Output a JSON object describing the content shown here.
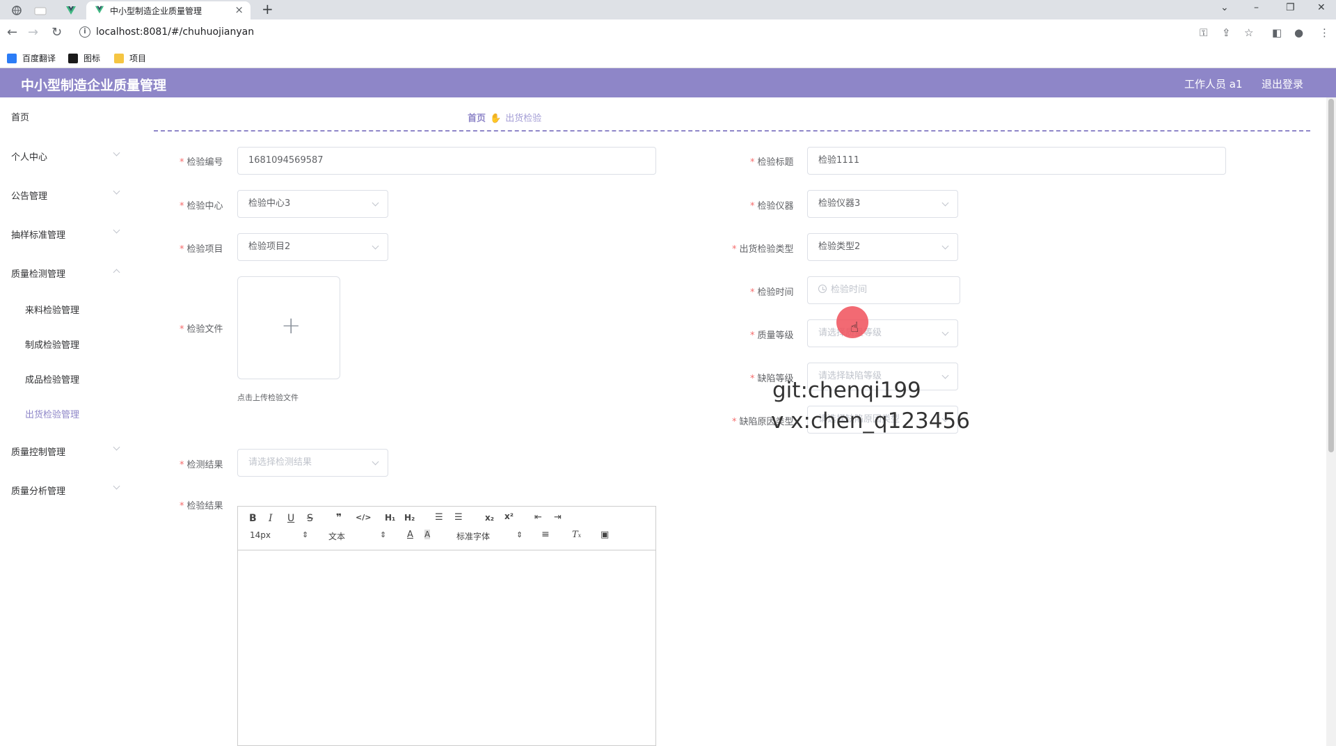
{
  "browser": {
    "tab_title": "中小型制造企业质量管理",
    "tab_close": "×",
    "new_tab": "+",
    "url": "localhost:8081/#/chuhuojianyan",
    "bookmarks": [
      {
        "label": "百度翻译",
        "color": "#2b7cf6"
      },
      {
        "label": "图标",
        "color": "#1a1a1a"
      },
      {
        "label": "项目",
        "color": "#f5c542"
      }
    ],
    "window_controls": [
      "⌄",
      "–",
      "❐",
      "✕"
    ]
  },
  "header": {
    "app_title": "中小型制造企业质量管理",
    "user_label": "工作人员 a1",
    "logout_label": "退出登录",
    "bg_color": "#8e86c8"
  },
  "sidebar": {
    "items": [
      {
        "label": "首页"
      },
      {
        "label": "个人中心"
      },
      {
        "label": "公告管理"
      },
      {
        "label": "抽样标准管理"
      },
      {
        "label": "质量检测管理"
      },
      {
        "label": "质量控制管理"
      },
      {
        "label": "质量分析管理"
      }
    ],
    "sub_items": [
      {
        "label": "来料检验管理"
      },
      {
        "label": "制成检验管理"
      },
      {
        "label": "成品检验管理"
      },
      {
        "label": "出货检验管理"
      }
    ]
  },
  "breadcrumb": {
    "home": "首页",
    "current": "出货检验"
  },
  "form": {
    "inspection_no": {
      "label": "检验编号",
      "value": "1681094569587"
    },
    "inspection_title": {
      "label": "检验标题",
      "value": "检验1111"
    },
    "inspection_center": {
      "label": "检验中心",
      "value": "检验中心3"
    },
    "inspection_instrument": {
      "label": "检验仪器",
      "value": "检验仪器3"
    },
    "inspection_item": {
      "label": "检验项目",
      "value": "检验项目2"
    },
    "shipment_type": {
      "label": "出货检验类型",
      "value": "检验类型2"
    },
    "inspection_time": {
      "label": "检验时间",
      "placeholder": "检验时间"
    },
    "quality_grade": {
      "label": "质量等级",
      "placeholder": "请选择质量等级"
    },
    "defect_grade": {
      "label": "缺陷等级",
      "placeholder": "请选择缺陷等级"
    },
    "defect_cause": {
      "label": "缺陷原因类型",
      "placeholder": "请选择缺陷原因类型"
    },
    "inspection_file": {
      "label": "检验文件",
      "upload_tip": "点击上传检验文件"
    },
    "test_result_select": {
      "label": "检测结果",
      "placeholder": "请选择检测结果"
    },
    "inspection_result": {
      "label": "检验结果"
    },
    "required_mark": "*"
  },
  "editor": {
    "font_size": "14px",
    "text_type": "文本",
    "font_family": "标准字体"
  },
  "overlay": {
    "watermark_line1": "git:chenqi199",
    "watermark_line2": "v x:chen_q123456"
  }
}
